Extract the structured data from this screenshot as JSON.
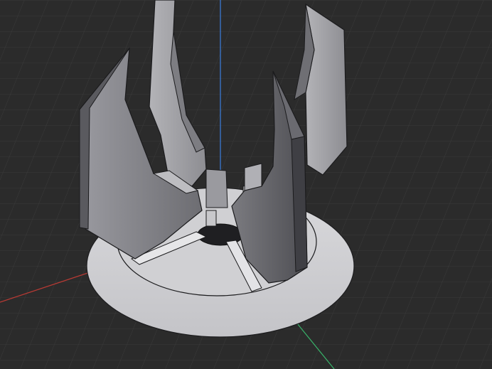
{
  "viewport": {
    "background": "#2b2b2b",
    "grid_color": "#3a3a3a",
    "axis_colors": {
      "x": "#c0392b",
      "y": "#2ecc71",
      "z": "#3b82f6"
    },
    "model_colors": {
      "base": "#cfcfd2",
      "base_shadow": "#b6b6ba",
      "fin_light": "#a9a9ad",
      "fin_mid": "#8e8e92",
      "fin_dark": "#5f5f64",
      "edge": "#1b1b1d"
    }
  }
}
